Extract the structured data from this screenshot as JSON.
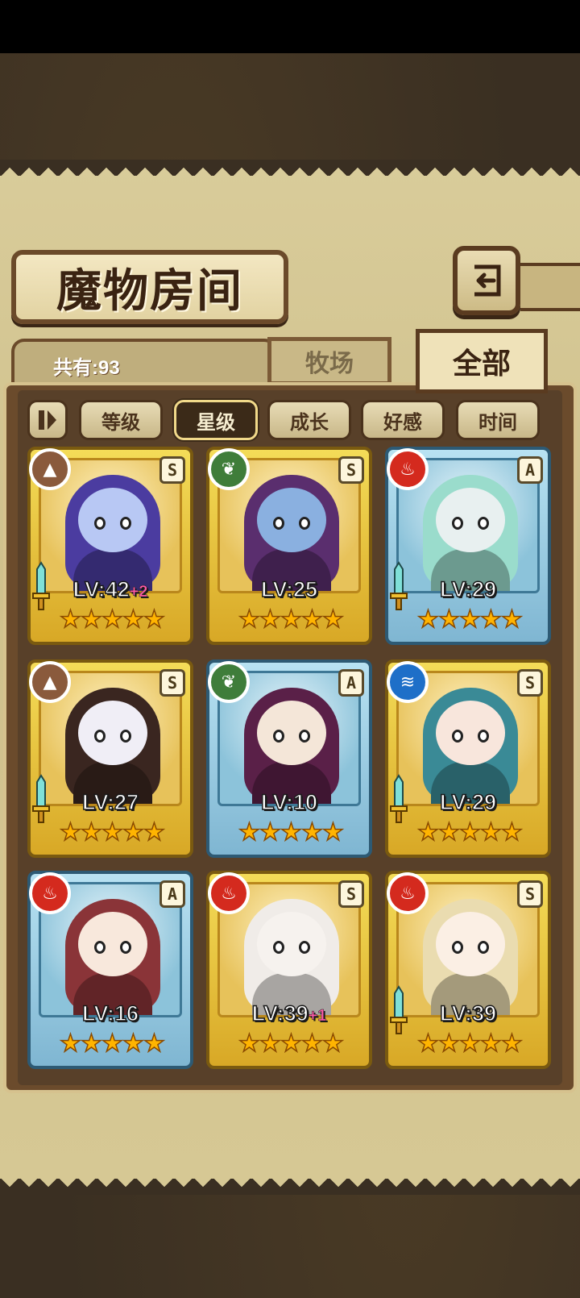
{
  "title": "魔物房间",
  "count_label": "共有:93",
  "tabs": [
    {
      "label": "牧场",
      "active": false
    },
    {
      "label": "全部",
      "active": true
    }
  ],
  "filters": [
    {
      "label": "等级",
      "active": false
    },
    {
      "label": "星级",
      "active": true
    },
    {
      "label": "成长",
      "active": false
    },
    {
      "label": "好感",
      "active": false
    },
    {
      "label": "时间",
      "active": false
    }
  ],
  "element_colors": {
    "earth": "#8a5a3c",
    "wind": "#3f7d3a",
    "fire": "#d42a1e",
    "water": "#1e6fc8"
  },
  "monsters": [
    {
      "level": "LV:42",
      "bonus": "+2",
      "rank": "S",
      "element": "earth",
      "frame": "gold",
      "sword": true,
      "stars": 5,
      "hair": "#4b3ca0",
      "skin": "#b8c8f4"
    },
    {
      "level": "LV:25",
      "bonus": "",
      "rank": "S",
      "element": "wind",
      "frame": "gold",
      "sword": false,
      "stars": 5,
      "hair": "#5a2e6e",
      "skin": "#8ab0e0"
    },
    {
      "level": "LV:29",
      "bonus": "",
      "rank": "A",
      "element": "fire",
      "frame": "blue",
      "sword": true,
      "stars": 5,
      "hair": "#9adccc",
      "skin": "#e8f0f0"
    },
    {
      "level": "LV:27",
      "bonus": "",
      "rank": "S",
      "element": "earth",
      "frame": "gold",
      "sword": true,
      "stars": 5,
      "hair": "#3a2620",
      "skin": "#f0eef6"
    },
    {
      "level": "LV:10",
      "bonus": "",
      "rank": "A",
      "element": "wind",
      "frame": "blue",
      "sword": false,
      "stars": 5,
      "hair": "#5a2048",
      "skin": "#f4e6d8"
    },
    {
      "level": "LV:29",
      "bonus": "",
      "rank": "S",
      "element": "water",
      "frame": "gold",
      "sword": true,
      "stars": 5,
      "hair": "#3a8a96",
      "skin": "#f8e6dc"
    },
    {
      "level": "LV:16",
      "bonus": "",
      "rank": "A",
      "element": "fire",
      "frame": "blue",
      "sword": false,
      "stars": 5,
      "hair": "#8a3438",
      "skin": "#f8e8dc"
    },
    {
      "level": "LV:39",
      "bonus": "+1",
      "rank": "S",
      "element": "fire",
      "frame": "gold",
      "sword": false,
      "stars": 5,
      "hair": "#f0ece8",
      "skin": "#f6f2ee"
    },
    {
      "level": "LV:39",
      "bonus": "",
      "rank": "S",
      "element": "fire",
      "frame": "gold",
      "sword": true,
      "stars": 5,
      "hair": "#eadcb0",
      "skin": "#fbefe4"
    }
  ]
}
